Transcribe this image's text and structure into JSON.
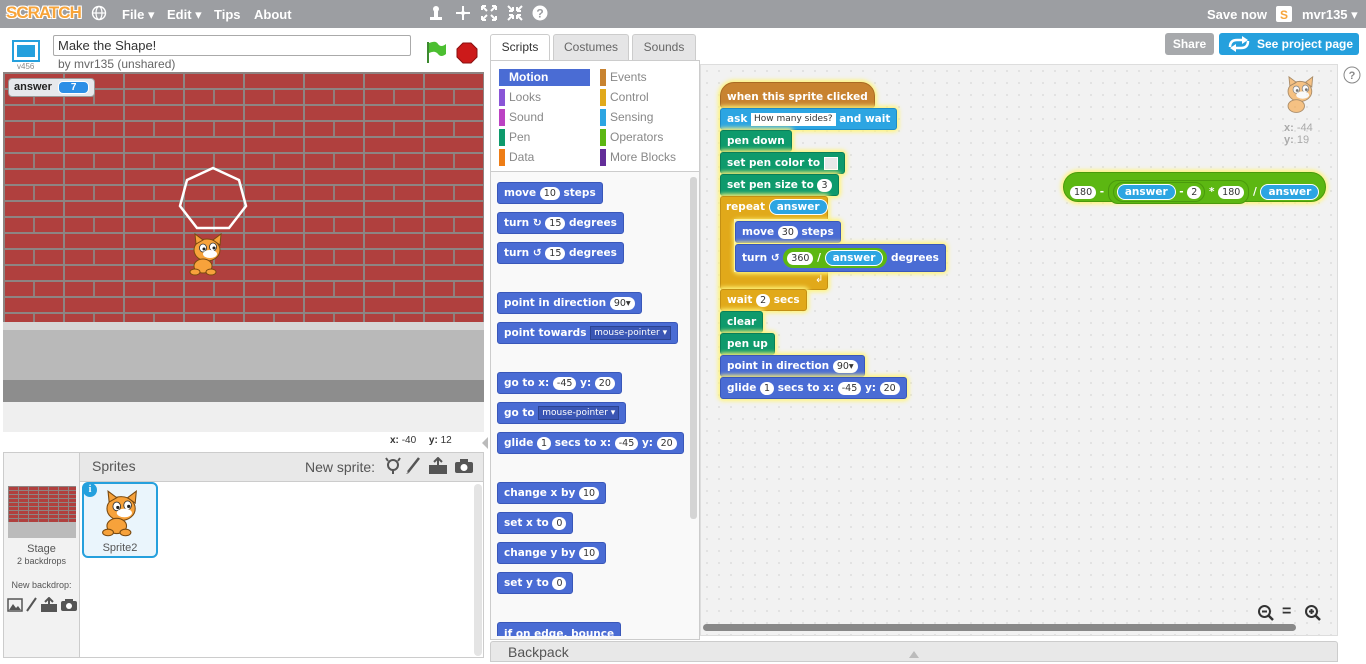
{
  "menubar": {
    "logo": "SCRATCH",
    "file": "File ▾",
    "edit": "Edit ▾",
    "tips": "Tips",
    "about": "About",
    "save_now": "Save now",
    "username": "mvr135 ▾"
  },
  "project": {
    "title": "Make the Shape!",
    "author": "by mvr135 (unshared)",
    "version": "v456",
    "share": "Share",
    "see_project_page": "See project page"
  },
  "stage": {
    "monitor_label": "answer",
    "monitor_value": "7",
    "mouse_x_label": "x:",
    "mouse_x": "-40",
    "mouse_y_label": "y:",
    "mouse_y": "12"
  },
  "sprites_panel": {
    "header": "Sprites",
    "new_sprite": "New sprite:",
    "stage_label": "Stage",
    "stage_backdrops": "2 backdrops",
    "new_backdrop": "New backdrop:",
    "sprite_name": "Sprite2"
  },
  "tabs": [
    "Scripts",
    "Costumes",
    "Sounds"
  ],
  "categories": {
    "left": [
      "Motion",
      "Looks",
      "Sound",
      "Pen",
      "Data"
    ],
    "right": [
      "Events",
      "Control",
      "Sensing",
      "Operators",
      "More Blocks"
    ],
    "colors": {
      "Motion": "#4a6cd4",
      "Looks": "#8a55d7",
      "Sound": "#bb42c3",
      "Pen": "#0e9a6c",
      "Data": "#ee7d16",
      "Events": "#c88330",
      "Control": "#e1a91a",
      "Sensing": "#2ca5e2",
      "Operators": "#5cb712",
      "More Blocks": "#632d99"
    }
  },
  "palette": {
    "move": "move",
    "move_n": "10",
    "steps": "steps",
    "turn": "turn",
    "turn_cw_n": "15",
    "degrees": "degrees",
    "turn_ccw_n": "15",
    "point_dir": "point in direction",
    "point_dir_n": "90▾",
    "point_towards": "point towards",
    "mouse_pointer": "mouse-pointer",
    "goto_x": "go to x:",
    "goto_x_n": "-45",
    "y": "y:",
    "goto_y_n": "20",
    "goto": "go to",
    "glide": "glide",
    "glide_n": "1",
    "secs_to_x": "secs to x:",
    "glide_x": "-45",
    "glide_y": "20",
    "change_x": "change x by",
    "change_x_n": "10",
    "set_x": "set x to",
    "set_x_n": "0",
    "change_y": "change y by",
    "change_y_n": "10",
    "set_y": "set y to",
    "set_y_n": "0",
    "bounce": "if on edge, bounce"
  },
  "script": {
    "hat": "when this sprite clicked",
    "ask": "ask",
    "ask_text": "How many sides?",
    "and_wait": "and wait",
    "pen_down": "pen down",
    "set_pen_color": "set pen color to",
    "set_pen_size": "set pen size to",
    "pen_size": "3",
    "repeat": "repeat",
    "answer": "answer",
    "move": "move",
    "move_n": "30",
    "steps": "steps",
    "turn": "turn",
    "n360": "360",
    "slash": "/",
    "degrees": "degrees",
    "wait": "wait",
    "wait_n": "2",
    "secs": "secs",
    "clear": "clear",
    "pen_up": "pen up",
    "point_dir": "point in direction",
    "point_dir_n": "90▾",
    "glide": "glide",
    "glide_n": "1",
    "secs_to_x": "secs to x:",
    "glide_x": "-45",
    "y": "y:",
    "glide_y": "20",
    "loose_180": "180",
    "minus": "-",
    "n2": "2",
    "times": "*",
    "n180": "180"
  },
  "sprite_info": {
    "x_label": "x:",
    "x": "-44",
    "y_label": "y:",
    "y": "19"
  },
  "backpack": "Backpack"
}
